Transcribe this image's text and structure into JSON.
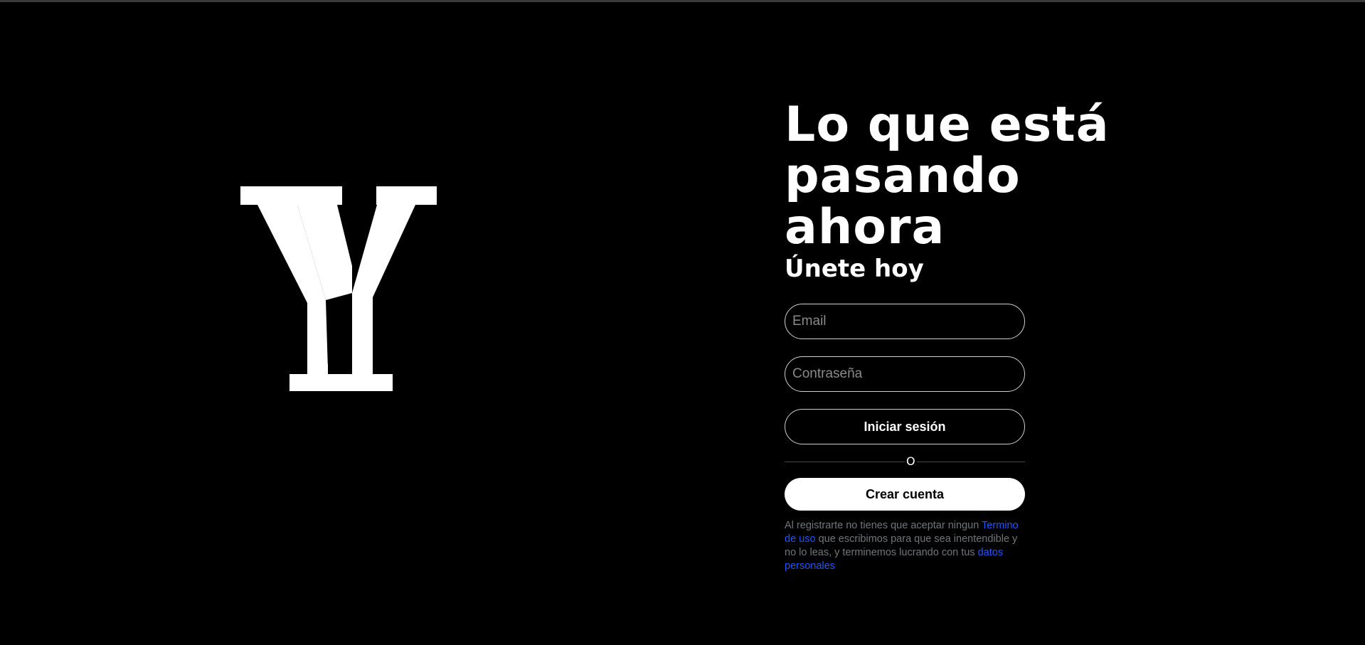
{
  "logo": {
    "icon": "y-logo-icon",
    "color": "#ffffff"
  },
  "main": {
    "headline": "Lo que está\npasando ahora",
    "subheadline": "Únete hoy"
  },
  "form": {
    "email_placeholder": "Email",
    "password_placeholder": "Contraseña",
    "login_label": "Iniciar sesión",
    "divider_label": "O",
    "create_label": "Crear cuenta"
  },
  "terms": {
    "text_before": "Al registrarte no tienes que aceptar ningun ",
    "terms_link": "Termino de uso",
    "text_middle": " que escribimos para que sea inentendible y no lo leas, y terminemos lucrando con tus ",
    "data_link": "datos personales"
  },
  "colors": {
    "background": "#000000",
    "link": "#1d55ff",
    "muted_text": "#71767b",
    "divider": "#3f4a55"
  }
}
